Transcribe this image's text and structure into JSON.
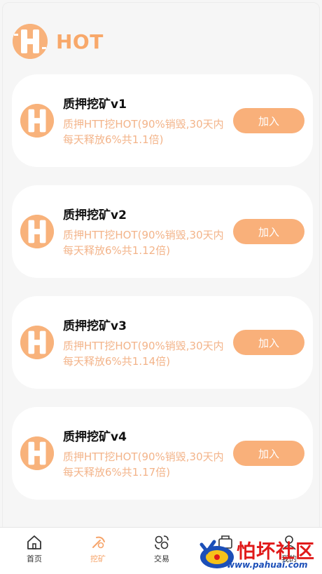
{
  "header": {
    "brand": "HOT"
  },
  "cards": [
    {
      "title": "质押挖矿v1",
      "desc": "质押HTT挖HOT(90%销毁,30天内每天释放6%共1.1倍)",
      "button": "加入"
    },
    {
      "title": "质押挖矿v2",
      "desc": "质押HTT挖HOT(90%销毁,30天内每天释放6%共1.12倍)",
      "button": "加入"
    },
    {
      "title": "质押挖矿v3",
      "desc": "质押HTT挖HOT(90%销毁,30天内每天释放6%共1.14倍)",
      "button": "加入"
    },
    {
      "title": "质押挖矿v4",
      "desc": "质押HTT挖HOT(90%销毁,30天内每天释放6%共1.17倍)",
      "button": "加入"
    }
  ],
  "tabbar": {
    "items": [
      {
        "label": "首页",
        "icon": "home-icon"
      },
      {
        "label": "挖矿",
        "icon": "mining-icon",
        "active": true
      },
      {
        "label": "交易",
        "icon": "exchange-icon"
      },
      {
        "label": "资金",
        "icon": "funds-icon"
      },
      {
        "label": "我的",
        "icon": "user-icon"
      }
    ]
  },
  "watermark": {
    "text": "怕坏社区",
    "url": "www.pahuai.com"
  },
  "colors": {
    "accent": "#f8b27b",
    "accent_text": "#f3b48a",
    "button": "#f9b07a",
    "background": "#f6f6f6"
  }
}
